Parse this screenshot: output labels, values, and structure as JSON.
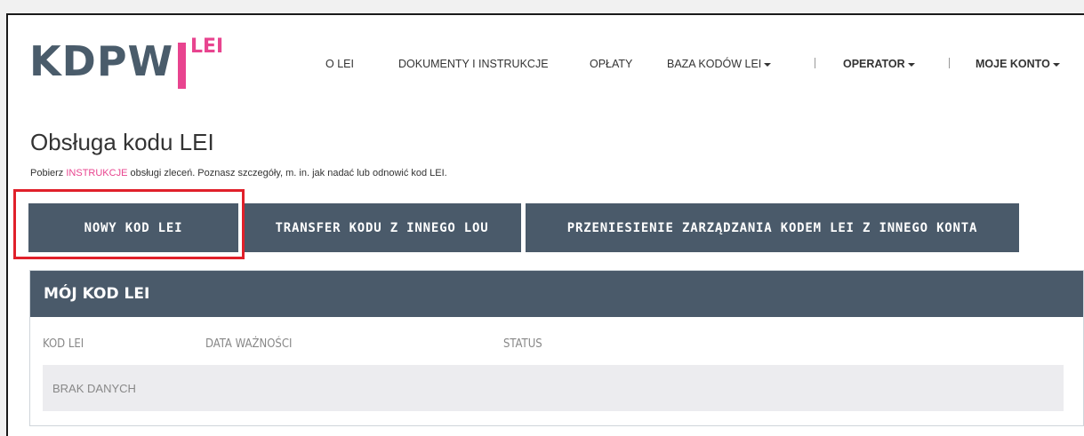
{
  "brand": {
    "logo_text": "KDPW",
    "logo_sub": "LEI"
  },
  "nav": {
    "items": [
      {
        "label": "O LEI"
      },
      {
        "label": "DOKUMENTY I INSTRUKCJE"
      },
      {
        "label": "OPŁATY"
      },
      {
        "label": "BAZA KODÓW LEI"
      },
      {
        "label": "OPERATOR"
      },
      {
        "label": "MOJE KONTO"
      }
    ]
  },
  "page": {
    "title": "Obsługa kodu LEI",
    "intro_prefix": "Pobierz ",
    "intro_link": "INSTRUKCJE",
    "intro_suffix": " obsługi zleceń. Poznasz szczegóły, m. in. jak nadać lub odnowić kod LEI."
  },
  "actions": {
    "new_code": "NOWY KOD LEI",
    "transfer": "TRANSFER KODU Z INNEGO LOU",
    "move_management": "PRZENIESIENIE ZARZĄDZANIA KODEM LEI Z INNEGO KONTA"
  },
  "panel": {
    "title": "MÓJ KOD LEI",
    "columns": [
      "KOD LEI",
      "DATA WAŻNOŚCI",
      "STATUS"
    ],
    "empty_text": "BRAK DANYCH"
  },
  "colors": {
    "accent": "#e8448f",
    "slate": "#4a5a6a",
    "highlight": "#e0202a"
  }
}
